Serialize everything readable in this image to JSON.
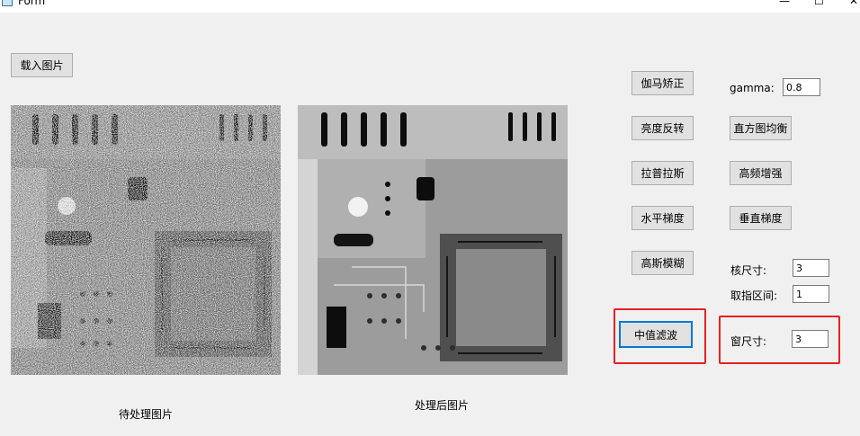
{
  "window": {
    "title": "Form",
    "minimize_glyph": "—",
    "maximize_glyph": "☐",
    "close_glyph": "✕"
  },
  "toolbar": {
    "load_label": "载入图片"
  },
  "images": {
    "original_caption": "待处理图片",
    "processed_caption": "处理后图片"
  },
  "buttons": {
    "gamma": "伽马矫正",
    "invert": "亮度反转",
    "laplace": "拉普拉斯",
    "horizontal_gradient": "水平梯度",
    "gaussian_blur": "高斯模糊",
    "median_filter": "中值滤波",
    "histogram_eq": "直方图均衡",
    "high_freq": "高频增强",
    "vertical_gradient": "垂直梯度"
  },
  "params": {
    "gamma_label": "gamma:",
    "gamma_value": "0.8",
    "kernel_label": "核尺寸:",
    "kernel_value": "3",
    "range_label": "取指区间:",
    "range_value": "1",
    "window_label": "窗尺寸:",
    "window_value": "3"
  },
  "colors": {
    "highlight": "#e62222",
    "button_bg": "#e1e1e1",
    "button_border": "#adadad",
    "form_bg": "#f0f0f0"
  }
}
